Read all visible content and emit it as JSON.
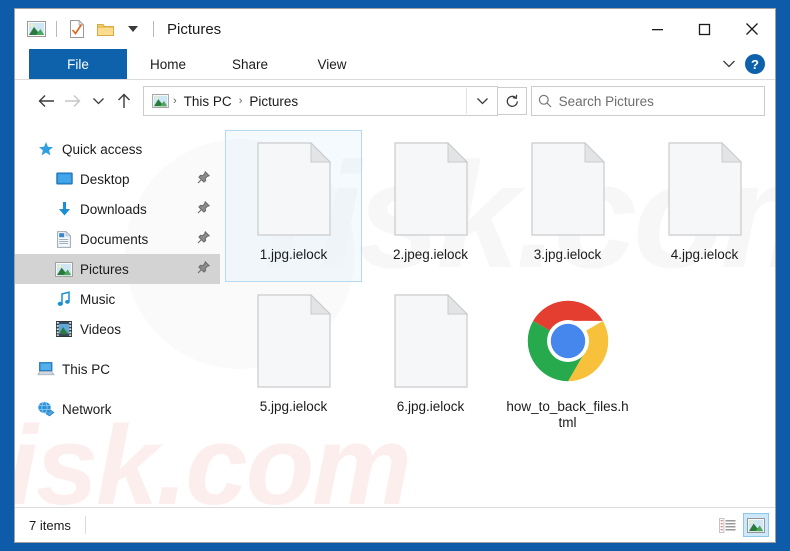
{
  "window": {
    "title": "Pictures",
    "quick_access_toolbar": [
      {
        "name": "pictures-folder-icon",
        "label": "Pictures"
      },
      {
        "name": "properties-icon",
        "label": "Properties"
      },
      {
        "name": "new-folder-icon",
        "label": "New folder"
      },
      {
        "name": "customize-chevron-icon",
        "label": "Customize Quick Access Toolbar"
      }
    ],
    "controls": {
      "minimize": "—",
      "maximize": "☐",
      "close": "✕"
    }
  },
  "ribbon": {
    "tabs": [
      {
        "label": "File",
        "active": true
      },
      {
        "label": "Home",
        "active": false
      },
      {
        "label": "Share",
        "active": false
      },
      {
        "label": "View",
        "active": false
      }
    ],
    "collapse_icon": "chevron-down-icon",
    "help_label": "?"
  },
  "address_bar": {
    "back_icon": "←",
    "forward_icon": "→",
    "recent_icon": "⌄",
    "up_icon": "↑",
    "breadcrumb": [
      "This PC",
      "Pictures"
    ],
    "separator": "›",
    "dropdown_icon": "⌄",
    "refresh_icon": "↻"
  },
  "search": {
    "placeholder": "Search Pictures",
    "value": "",
    "icon": "search-icon"
  },
  "sidebar": {
    "items": [
      {
        "label": "Quick access",
        "icon": "star-icon",
        "level": "root",
        "pinned": false,
        "selected": false
      },
      {
        "label": "Desktop",
        "icon": "desktop-icon",
        "level": "child",
        "pinned": true,
        "selected": false
      },
      {
        "label": "Downloads",
        "icon": "download-icon",
        "level": "child",
        "pinned": true,
        "selected": false
      },
      {
        "label": "Documents",
        "icon": "documents-icon",
        "level": "child",
        "pinned": true,
        "selected": false
      },
      {
        "label": "Pictures",
        "icon": "pictures-icon",
        "level": "child",
        "pinned": true,
        "selected": true
      },
      {
        "label": "Music",
        "icon": "music-icon",
        "level": "child",
        "pinned": false,
        "selected": false
      },
      {
        "label": "Videos",
        "icon": "videos-icon",
        "level": "child",
        "pinned": false,
        "selected": false
      },
      {
        "label": "This PC",
        "icon": "this-pc-icon",
        "level": "root",
        "pinned": false,
        "selected": false
      },
      {
        "label": "Network",
        "icon": "network-icon",
        "level": "root",
        "pinned": false,
        "selected": false
      }
    ],
    "pin_glyph": "📌"
  },
  "files": [
    {
      "name": "1.jpg.ielock",
      "icon": "generic-file-icon",
      "selected": true
    },
    {
      "name": "2.jpeg.ielock",
      "icon": "generic-file-icon",
      "selected": false
    },
    {
      "name": "3.jpg.ielock",
      "icon": "generic-file-icon",
      "selected": false
    },
    {
      "name": "4.jpg.ielock",
      "icon": "generic-file-icon",
      "selected": false
    },
    {
      "name": "5.jpg.ielock",
      "icon": "generic-file-icon",
      "selected": false
    },
    {
      "name": "6.jpg.ielock",
      "icon": "generic-file-icon",
      "selected": false
    },
    {
      "name": "how_to_back_files.html",
      "icon": "chrome-icon",
      "selected": false
    }
  ],
  "status_bar": {
    "item_count": "7 items",
    "view_buttons": [
      {
        "name": "details-view-button",
        "label": "Details view",
        "active": false
      },
      {
        "name": "large-icons-view-button",
        "label": "Large icons view",
        "active": true
      }
    ]
  },
  "watermark": {
    "text": "risk.com"
  },
  "colors": {
    "frame_blue": "#0e5ca9",
    "file_tab_blue": "#0d62ab",
    "selection_border": "#b4daf2",
    "sidebar_selected": "#d3d3d3",
    "chrome_red": "#e43e30",
    "chrome_yellow": "#f8c13b",
    "chrome_green": "#27a94d",
    "chrome_blue": "#4587ed"
  }
}
